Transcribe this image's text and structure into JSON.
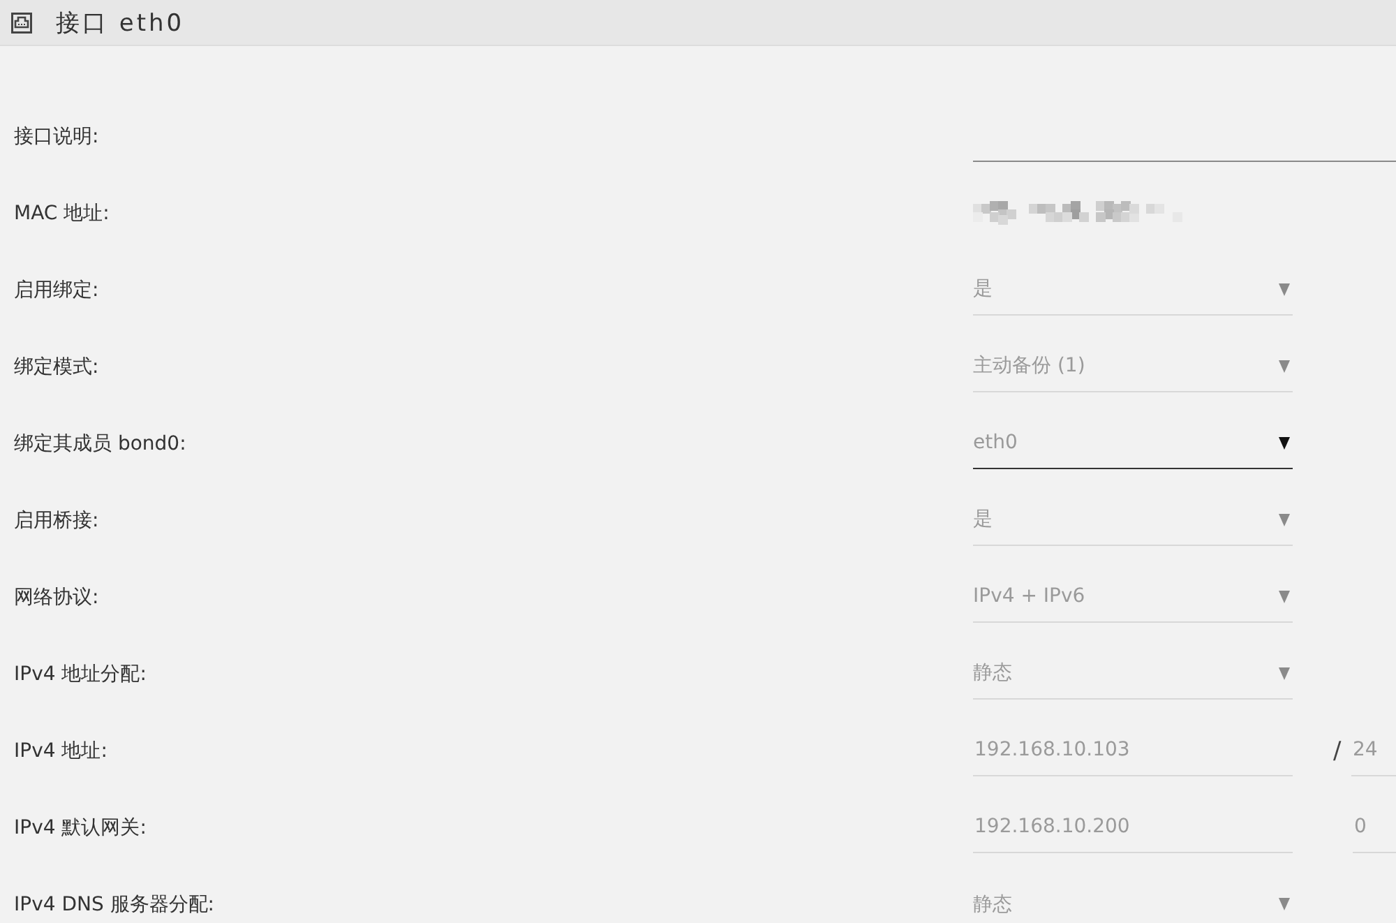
{
  "header": {
    "title": "接口 eth0"
  },
  "fields": [
    {
      "kind": "text",
      "label": "接口说明:",
      "disabled": false
    },
    {
      "kind": "redacted",
      "label": "MAC 地址:"
    },
    {
      "kind": "select",
      "label": "启用绑定:",
      "value": "是",
      "disabled": true
    },
    {
      "kind": "select",
      "label": "绑定模式:",
      "value": "主动备份 (1)",
      "disabled": true
    },
    {
      "kind": "select",
      "label": "绑定其成员 bond0:",
      "value": "eth0",
      "disabled": false
    },
    {
      "kind": "select",
      "label": "启用桥接:",
      "value": "是",
      "disabled": true
    },
    {
      "kind": "select",
      "label": "网络协议:",
      "value": "IPv4 + IPv6",
      "disabled": true
    },
    {
      "kind": "select",
      "label": "IPv4 地址分配:",
      "value": "静态",
      "disabled": true
    },
    {
      "kind": "text",
      "label": "IPv4 地址:",
      "value": "192.168.10.103",
      "disabled": true,
      "extra": {
        "separator": "/",
        "value": "24"
      }
    },
    {
      "kind": "text",
      "label": "IPv4 默认网关:",
      "value": "192.168.10.200",
      "disabled": true,
      "extra": {
        "value": "0"
      }
    },
    {
      "kind": "select",
      "label": "IPv4 DNS 服务器分配:",
      "value": "静态",
      "disabled": true
    }
  ]
}
